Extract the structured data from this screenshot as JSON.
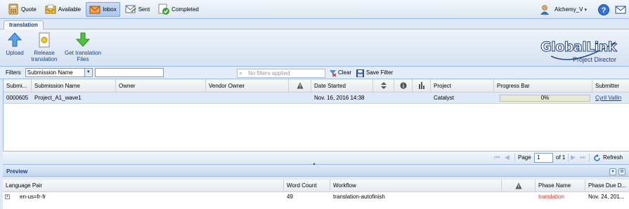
{
  "toolbar": {
    "quote": "Quote",
    "available": "Available",
    "inbox": "Inbox",
    "sent": "Sent",
    "completed": "Completed",
    "user": "Alchemy_V"
  },
  "tab": {
    "label": "translation"
  },
  "ribbon": {
    "upload": "Upload",
    "release_1": "Release",
    "release_2": "translation",
    "get_1": "Get translation",
    "get_2": "Files",
    "logo_main": "GlobalLink",
    "logo_sub": "Project Director"
  },
  "filters": {
    "label": "Filters",
    "selected": "Submission Name",
    "value": "",
    "applied_placeholder": "No filters applied",
    "clear": "Clear",
    "save": "Save Filter"
  },
  "grid": {
    "columns": [
      "Submi...",
      "Submission Name",
      "Owner",
      "Vendor Owner",
      "Date Started",
      "Project",
      "Progress Bar",
      "Submitter"
    ],
    "rows": [
      {
        "id": "0000605",
        "name": "Project_A1_wave1",
        "owner": "",
        "vendor_owner": "",
        "date_started": "Nov. 16, 2016 14:38",
        "project": "Catalyst",
        "progress_label": "0%",
        "progress": 0,
        "submitter": "Cyril Vallin"
      }
    ]
  },
  "pager": {
    "page_label": "Page",
    "page_value": "1",
    "of_label": "of 1",
    "refresh": "Refresh"
  },
  "preview": {
    "title": "Preview",
    "columns": [
      "Language Pair",
      "Word Count",
      "Workflow",
      "Phase Name",
      "Phase Due D..."
    ],
    "rows": [
      {
        "language_pair": "en-us=fr-fr",
        "word_count": "49",
        "workflow": "translation-autofinish",
        "phase_name": "translation",
        "phase_due": "Nov. 24, 201..."
      }
    ]
  },
  "colors": {
    "accent": "#15428b",
    "selected_row": "#dfe8f6",
    "phase_red": "#c0392b"
  }
}
